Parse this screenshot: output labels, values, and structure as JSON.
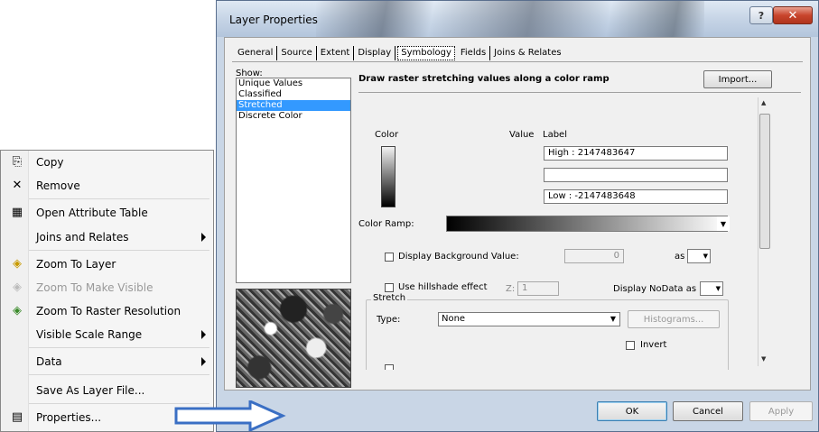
{
  "dialog": {
    "title": "Layer Properties",
    "help_button": "?",
    "close_button": "✕",
    "tabs": [
      "General",
      "Source",
      "Extent",
      "Display",
      "Symbology",
      "Fields",
      "Joins & Relates"
    ],
    "active_tab": "Symbology",
    "show_label": "Show:",
    "show_items": [
      "Unique Values",
      "Classified",
      "Stretched",
      "Discrete Color"
    ],
    "show_selected": "Stretched",
    "header_text": "Draw raster stretching values along a color ramp",
    "import_button": "Import...",
    "columns": {
      "color": "Color",
      "value": "Value",
      "label": "Label"
    },
    "labels": {
      "high": "High : 2147483647",
      "mid": "",
      "low": "Low : -2147483648"
    },
    "color_ramp_label": "Color Ramp:",
    "background": {
      "label": "Display Background Value:",
      "value": "0",
      "as_label": "as"
    },
    "hillshade": {
      "label": "Use hillshade effect",
      "z_label": "Z:",
      "z_value": "1"
    },
    "nodata_label": "Display NoData as",
    "stretch": {
      "group_label": "Stretch",
      "type_label": "Type:",
      "type_value": "None",
      "histograms_button": "Histograms...",
      "invert_label": "Invert"
    },
    "footer": {
      "ok": "OK",
      "cancel": "Cancel",
      "apply": "Apply"
    }
  },
  "context_menu": {
    "items": [
      {
        "label": "Copy",
        "icon": "copy-icon"
      },
      {
        "label": "Remove",
        "icon": "remove-icon"
      },
      {
        "label": "Open Attribute Table",
        "icon": "table-icon"
      },
      {
        "label": "Joins and Relates",
        "icon": "",
        "submenu": true
      },
      {
        "label": "Zoom To Layer",
        "icon": "zoom-to-layer-icon"
      },
      {
        "label": "Zoom To Make Visible",
        "icon": "zoom-visible-icon",
        "disabled": true
      },
      {
        "label": "Zoom To Raster Resolution",
        "icon": "zoom-resolution-icon"
      },
      {
        "label": "Visible Scale Range",
        "icon": "",
        "submenu": true
      },
      {
        "label": "Data",
        "icon": "",
        "submenu": true
      },
      {
        "label": "Save As Layer File...",
        "icon": ""
      },
      {
        "label": "Properties...",
        "icon": "properties-icon"
      }
    ]
  },
  "colors": {
    "selection": "#3399ff",
    "arrow": "#3a6fc4",
    "close_button": "#c8452c"
  }
}
